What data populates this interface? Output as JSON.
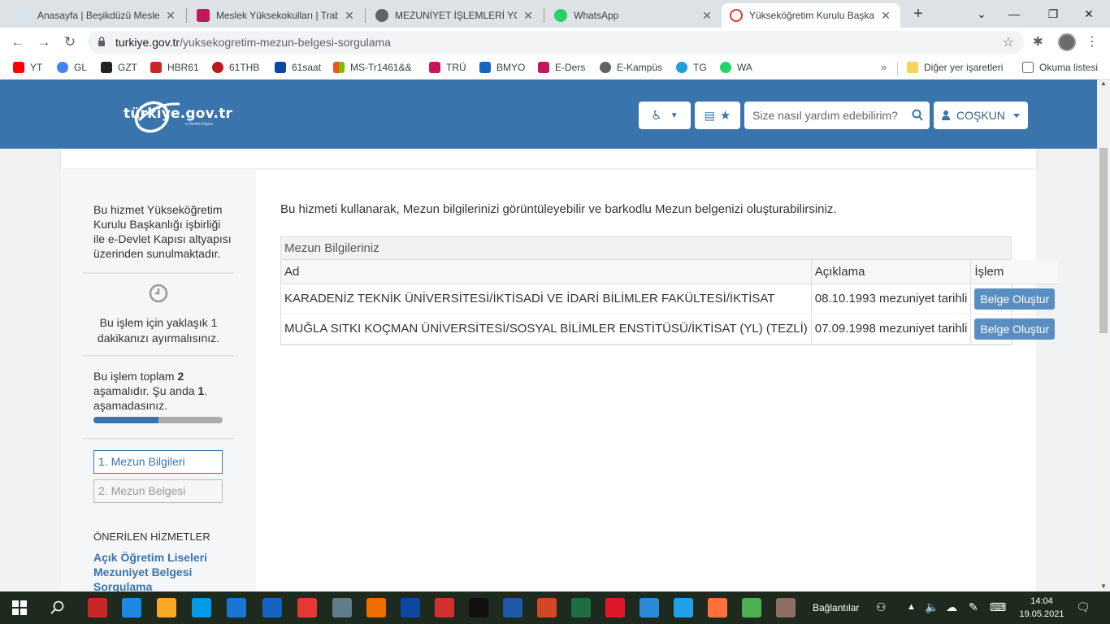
{
  "browser": {
    "tabs": [
      {
        "title": "Anasayfa | Beşikdüzü Meslek",
        "color": "#d8e3f0",
        "active": false
      },
      {
        "title": "Meslek Yüksekokulları | Trabz",
        "color": "#c2185b",
        "active": false
      },
      {
        "title": "MEZUNİYET İŞLEMLERİ YOL H",
        "color": "#5f6368",
        "active": false
      },
      {
        "title": "WhatsApp",
        "color": "#25d366",
        "active": false
      },
      {
        "title": "Yükseköğretim Kurulu Başkan",
        "color": "#e53935",
        "active": true
      }
    ],
    "url_domain": "turkiye.gov.tr",
    "url_path": "/yuksekogretim-mezun-belgesi-sorgulama",
    "bookmarks": [
      {
        "label": "YT",
        "color": "#ff0000"
      },
      {
        "label": "GL",
        "color": "#4285f4"
      },
      {
        "label": "GZT",
        "color": "#222222"
      },
      {
        "label": "HBR61",
        "color": "#c62828"
      },
      {
        "label": "61THB",
        "color": "#b71c1c"
      },
      {
        "label": "61saat",
        "color": "#0d47a1"
      },
      {
        "label": "MS-Tr1461&&",
        "color": "#f25022"
      },
      {
        "label": "TRÜ",
        "color": "#c2185b"
      },
      {
        "label": "BMYO",
        "color": "#1565c0"
      },
      {
        "label": "E-Ders",
        "color": "#c2185b"
      },
      {
        "label": "E-Kampüs",
        "color": "#5f6368"
      },
      {
        "label": "TG",
        "color": "#229ed9"
      },
      {
        "label": "WA",
        "color": "#25d366"
      }
    ],
    "other_bookmarks": "Diğer yer işaretleri",
    "reading_list": "Okuma listesi"
  },
  "header": {
    "logo_text": "türkiye.gov.tr",
    "logo_sub": "e-Devlet Kapısı",
    "search_placeholder": "Size nasıl yardım edebilirim?",
    "user_name": "COŞKUN",
    "brand_color": "#3a74ac"
  },
  "sidebar": {
    "info": "Bu hizmet Yükseköğretim Kurulu Başkanlığı işbirliği ile e-Devlet Kapısı altyapısı üzerinden sunulmaktadır.",
    "time_note": "Bu işlem için yaklaşık 1 dakikanızı ayırmalısınız.",
    "steps_text_1": "Bu işlem toplam ",
    "steps_total": "2",
    "steps_text_2": " aşamalıdır. Şu anda ",
    "steps_current": "1",
    "steps_text_3": ". aşamadasınız.",
    "progress_fraction": 0.5,
    "step1": "1. Mezun Bilgileri",
    "step2": "2. Mezun Belgesi",
    "recommended_title": "ÖNERİLEN HİZMETLER",
    "recommended": [
      "Açık Öğretim Liseleri",
      "Mezuniyet Belgesi",
      "Sorgulama"
    ]
  },
  "main": {
    "intro": "Bu hizmeti kullanarak, Mezun bilgilerinizi görüntüleyebilir ve barkodlu Mezun belgenizi oluşturabilirsiniz.",
    "table_caption": "Mezun Bilgileriniz",
    "columns": [
      "Ad",
      "Açıklama",
      "İşlem"
    ],
    "rows": [
      {
        "ad": "KARADENİZ TEKNİK ÜNİVERSİTESİ/İKTİSADİ VE İDARİ BİLİMLER FAKÜLTESİ/İKTİSAT",
        "aciklama": "08.10.1993 mezuniyet tarihli",
        "button": "Belge Oluştur"
      },
      {
        "ad": "MUĞLA SITKI KOÇMAN ÜNİVERSİTESİ/SOSYAL BİLİMLER ENSTİTÜSÜ/İKTİSAT (YL) (TEZLİ)",
        "aciklama": "07.09.1998 mezuniyet tarihli",
        "button": "Belge Oluştur"
      }
    ]
  },
  "taskbar": {
    "network_label": "Bağlantılar",
    "time": "14:04",
    "date": "19.05.2021",
    "apps": [
      {
        "name": "security",
        "color": "#c62828"
      },
      {
        "name": "store",
        "color": "#1e88e5"
      },
      {
        "name": "explorer",
        "color": "#f9a825"
      },
      {
        "name": "remote",
        "color": "#039be5"
      },
      {
        "name": "mail",
        "color": "#1976d2"
      },
      {
        "name": "app-1",
        "color": "#1565c0"
      },
      {
        "name": "app-2",
        "color": "#e53935"
      },
      {
        "name": "calculator",
        "color": "#607d8b"
      },
      {
        "name": "app-3",
        "color": "#ef6c00"
      },
      {
        "name": "photoshop",
        "color": "#0d47a1"
      },
      {
        "name": "acrobat",
        "color": "#d32f2f"
      },
      {
        "name": "recorder",
        "color": "#111111"
      },
      {
        "name": "word",
        "color": "#1e5aa8"
      },
      {
        "name": "powerpoint",
        "color": "#d24726"
      },
      {
        "name": "excel",
        "color": "#1d6f42"
      },
      {
        "name": "opera",
        "color": "#e0162b"
      },
      {
        "name": "edge",
        "color": "#2c8ad6"
      },
      {
        "name": "ie",
        "color": "#1ea1e8"
      },
      {
        "name": "firefox",
        "color": "#ff7139"
      },
      {
        "name": "chrome",
        "color": "#4caf50"
      },
      {
        "name": "chrome-profile",
        "color": "#8d6e63"
      }
    ]
  }
}
